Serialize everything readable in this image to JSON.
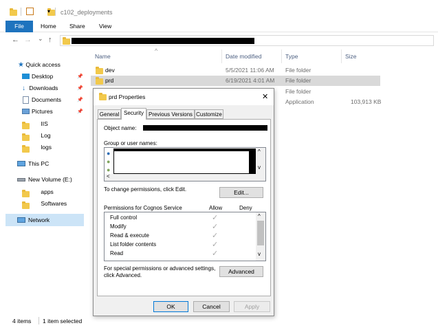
{
  "window": {
    "path_title": "c102_deployments"
  },
  "ribbon": {
    "tabs": [
      "File",
      "Home",
      "Share",
      "View"
    ]
  },
  "nav": {
    "back": "←",
    "forward": "→",
    "dropdown": "⌄",
    "up": "↑"
  },
  "sidebar": {
    "quick_access": "Quick access",
    "items": [
      "Desktop",
      "Downloads",
      "Documents",
      "Pictures",
      "IIS",
      "Log",
      "logs"
    ],
    "this_pc": "This PC",
    "volume": "New Volume (E:)",
    "volume_items": [
      "apps",
      "Softwares"
    ],
    "network": "Network"
  },
  "list": {
    "columns": {
      "name": "Name",
      "date": "Date modified",
      "type": "Type",
      "size": "Size"
    },
    "sort_indicator": "^",
    "rows": [
      {
        "name": "dev",
        "date": "5/5/2021 11:06 AM",
        "type": "File folder",
        "size": ""
      },
      {
        "name": "prd",
        "date": "6/19/2021 4:01 AM",
        "type": "File folder",
        "size": ""
      },
      {
        "name": "",
        "date": "",
        "type": "File folder",
        "size": ""
      },
      {
        "name": "",
        "date": "",
        "type": "Application",
        "size": "103,913 KB"
      }
    ]
  },
  "status": {
    "items": "4 items",
    "selected": "1 item selected"
  },
  "dialog": {
    "title": "prd Properties",
    "close": "✕",
    "tabs": [
      "General",
      "Security",
      "Previous Versions",
      "Customize"
    ],
    "object_name_label": "Object name:",
    "group_label": "Group or user names:",
    "change_text": "To change permissions, click Edit.",
    "edit_button": "Edit...",
    "perm_header": "Permissions for Cognos Service",
    "allow_header": "Allow",
    "deny_header": "Deny",
    "permissions": [
      "Full control",
      "Modify",
      "Read & execute",
      "List folder contents",
      "Read"
    ],
    "check_glyph": "✓",
    "special_text_1": "For special permissions or advanced settings,",
    "special_text_2": "click Advanced.",
    "advanced_button": "Advanced",
    "ok": "OK",
    "cancel": "Cancel",
    "apply": "Apply",
    "scroll_up": "^",
    "scroll_down": "v",
    "scroll_left": "<"
  },
  "colors": {
    "accent": "#1e73be",
    "selection": "#d9d9d9",
    "folder": "#f2c94c"
  }
}
